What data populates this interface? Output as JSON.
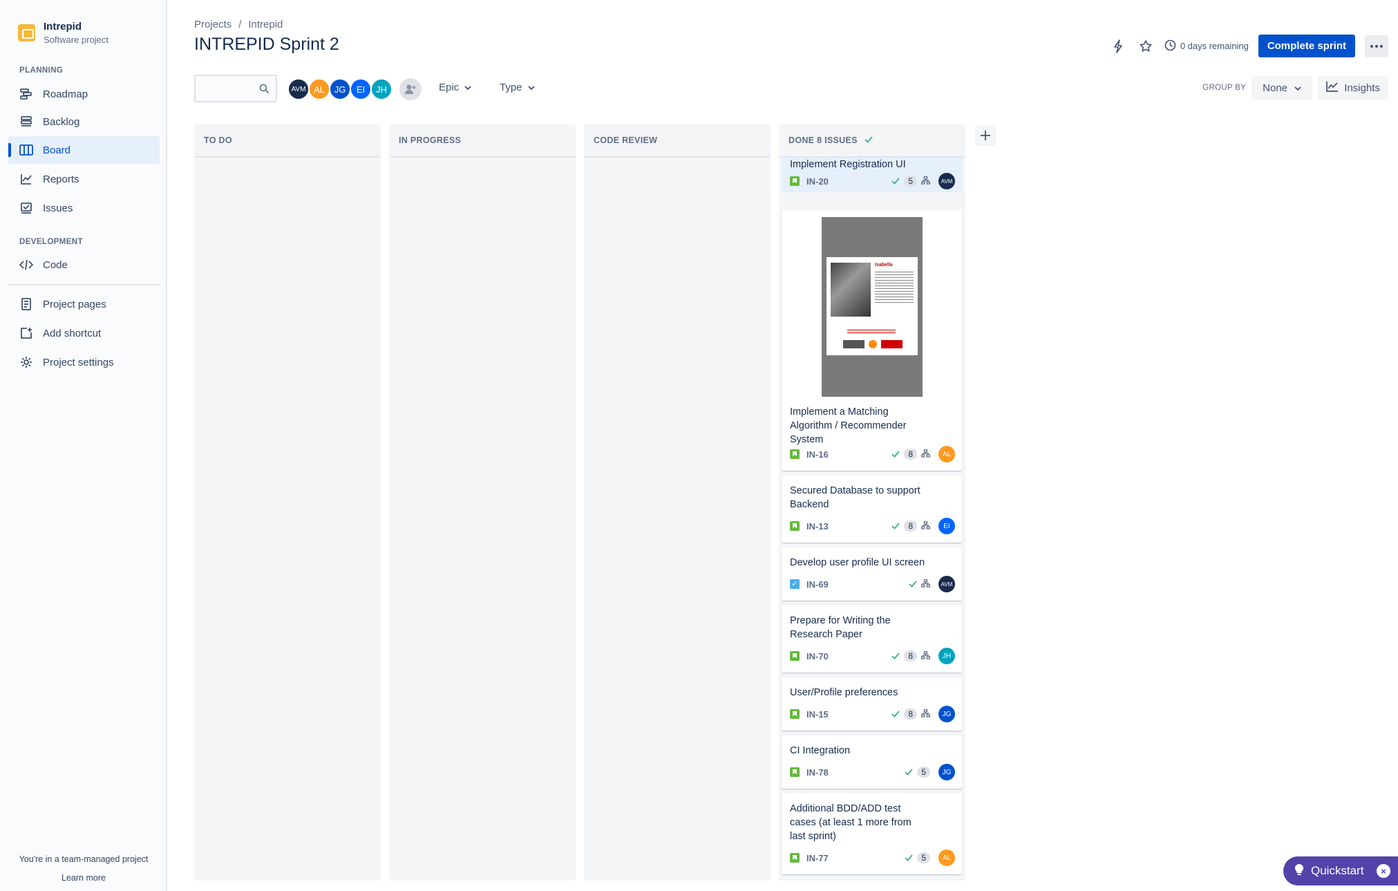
{
  "sidebar": {
    "project_name": "Intrepid",
    "project_type": "Software project",
    "planning_heading": "PLANNING",
    "development_heading": "DEVELOPMENT",
    "items": [
      {
        "label": "Roadmap"
      },
      {
        "label": "Backlog"
      },
      {
        "label": "Board"
      },
      {
        "label": "Reports"
      },
      {
        "label": "Issues"
      },
      {
        "label": "Code"
      },
      {
        "label": "Project pages"
      },
      {
        "label": "Add shortcut"
      },
      {
        "label": "Project settings"
      }
    ],
    "footer_text": "You're in a team-managed project",
    "footer_link": "Learn more"
  },
  "header": {
    "breadcrumb": [
      "Projects",
      "/",
      "Intrepid"
    ],
    "title": "INTREPID Sprint 2",
    "days_remaining": "0 days remaining",
    "complete_sprint": "Complete sprint"
  },
  "filters": {
    "search_placeholder": "",
    "avatars": [
      {
        "initials": "AVM",
        "color": "#172b4d"
      },
      {
        "initials": "AL",
        "color": "#ff991f"
      },
      {
        "initials": "JG",
        "color": "#0052cc"
      },
      {
        "initials": "EI",
        "color": "#0065ff"
      },
      {
        "initials": "JH",
        "color": "#00a3bf"
      }
    ],
    "epic_label": "Epic",
    "type_label": "Type",
    "group_by_label": "GROUP BY",
    "group_by_value": "None",
    "insights_label": "Insights"
  },
  "columns": [
    {
      "title": "TO DO"
    },
    {
      "title": "IN PROGRESS"
    },
    {
      "title": "CODE REVIEW"
    },
    {
      "title": "DONE 8 ISSUES"
    }
  ],
  "cards": [
    {
      "title": "Implement Registration UI",
      "key": "IN-20",
      "points": "5",
      "assignee": "AVM",
      "color": "#172b4d"
    },
    {
      "title": "Implement a Matching Algorithm / Recommender System",
      "key": "IN-16",
      "points": "8",
      "assignee": "AL",
      "color": "#ff991f"
    },
    {
      "title": "Secured Database to support Backend",
      "key": "IN-13",
      "points": "8",
      "assignee": "EI",
      "color": "#0065ff"
    },
    {
      "title": "Develop user profile UI screen",
      "key": "IN-69",
      "points": "",
      "assignee": "AVM",
      "color": "#172b4d"
    },
    {
      "title": "Prepare for Writing the Research Paper",
      "key": "IN-70",
      "points": "8",
      "assignee": "JH",
      "color": "#00a3bf"
    },
    {
      "title": "User/Profile preferences",
      "key": "IN-15",
      "points": "8",
      "assignee": "JG",
      "color": "#0052cc"
    },
    {
      "title": "CI Integration",
      "key": "IN-78",
      "points": "5",
      "assignee": "JG",
      "color": "#0052cc"
    },
    {
      "title": "Additional BDD/ADD test cases (at least 1 more from last sprint)",
      "key": "IN-77",
      "points": "5",
      "assignee": "AL",
      "color": "#ff991f"
    }
  ],
  "thumbnail": {
    "name": "Isabella"
  },
  "quickstart": {
    "label": "Quickstart",
    "close": "×"
  }
}
